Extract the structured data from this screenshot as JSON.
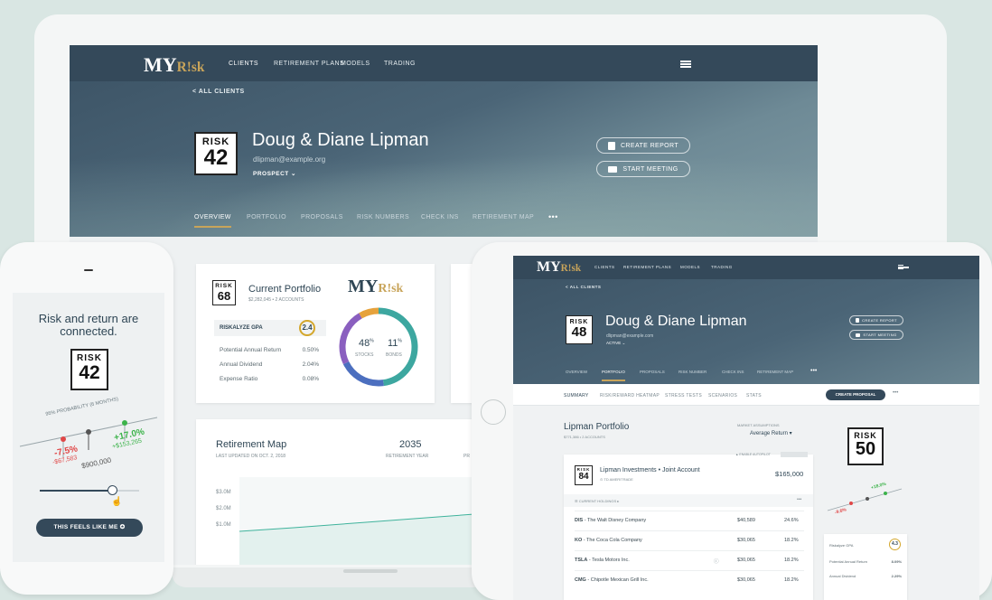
{
  "brand": {
    "logo_main": "MY",
    "logo_sub": "R!sk"
  },
  "laptop": {
    "nav": [
      "CLIENTS",
      "RETIREMENT PLANS",
      "MODELS",
      "TRADING"
    ],
    "back_link": "< ALL CLIENTS",
    "client": {
      "risk_label": "RISK",
      "risk_number": "42",
      "name": "Doug & Diane Lipman",
      "email": "dlipman@example.org",
      "status": "PROSPECT ⌄"
    },
    "buttons": {
      "create_report": "CREATE REPORT",
      "start_meeting": "START MEETING"
    },
    "tabs": [
      "OVERVIEW",
      "PORTFOLIO",
      "PROPOSALS",
      "RISK NUMBERS",
      "CHECK INS",
      "RETIREMENT MAP",
      "•••"
    ],
    "portfolio_card": {
      "risk_label": "RISK",
      "risk_number": "68",
      "title": "Current Portfolio",
      "subtitle": "$2,282,045 • 2 ACCOUNTS",
      "gpa_label": "RISKALYZE GPA",
      "gpa_value": "2.4",
      "rows": [
        {
          "label": "Potential Annual Return",
          "value": "0.50%"
        },
        {
          "label": "Annual Dividend",
          "value": "2.04%"
        },
        {
          "label": "Expense Ratio",
          "value": "0.08%"
        }
      ],
      "donut": {
        "stocks_pct": "48",
        "stocks_label": "STOCKS",
        "bonds_pct": "11",
        "bonds_label": "BONDS",
        "pct_sign": "%"
      }
    },
    "retirement_card": {
      "title": "Retirement Map",
      "updated": "LAST UPDATED ON OCT. 2, 2018",
      "year_value": "2035",
      "year_label": "RETIREMENT YEAR",
      "extra": "PR",
      "y_ticks": [
        "$3.0M",
        "$2.0M",
        "$1.0M"
      ]
    }
  },
  "phone": {
    "headline": "Risk and return are connected.",
    "risk_label": "RISK",
    "risk_number": "42",
    "probability": "95% PROBABILITY (6 MONTHS)",
    "down_pct": "-7.5%",
    "down_amt": "-$67,583",
    "up_pct": "+17.0%",
    "up_amt": "+$153,265",
    "center_amt": "$900,000",
    "cta": "THIS FEELS LIKE ME ✪"
  },
  "tablet": {
    "nav": [
      "CLIENTS",
      "RETIREMENT PLANS",
      "MODELS",
      "TRADING"
    ],
    "back_link": "< ALL CLIENTS",
    "client": {
      "risk_label": "RISK",
      "risk_number": "48",
      "name": "Doug & Diane Lipman",
      "email": "dlipman@example.com",
      "status": "ACTIVE ⌄"
    },
    "buttons": {
      "create_report": "CREATE REPORT",
      "start_meeting": "START MEETING"
    },
    "tabs": [
      "OVERVIEW",
      "PORTFOLIO",
      "PROPOSALS",
      "RISK NUMBER",
      "CHECK INS",
      "RETIREMENT MAP",
      "•••"
    ],
    "subtabs": [
      "SUMMARY",
      "RISK/REWARD HEATMAP",
      "STRESS TESTS",
      "SCENARIOS",
      "STATS"
    ],
    "create_proposal": "CREATE PROPOSAL",
    "portfolio_title": "Lipman Portfolio",
    "portfolio_sub": "$771,386 • 2 ACCOUNTS",
    "market_label": "MARKET ASSUMPTIONS",
    "market_value": "Average Return ▾",
    "account": {
      "risk_label": "RISK",
      "risk_number": "84",
      "name": "Lipman Investments • Joint Account",
      "sub": "⊙ TD AMERITRADE",
      "value": "$165,000",
      "autopilot": "▲ ENABLE AUTOPILOT"
    },
    "holdings_label": "☰ CURRENT HOLDINGS ▸",
    "holdings": [
      {
        "ticker": "DIS",
        "name": " - The Walt Disney Company",
        "value": "$40,589",
        "pct": "24.6%"
      },
      {
        "ticker": "KO",
        "name": " - The Coca Cola Company",
        "value": "$30,065",
        "pct": "18.2%"
      },
      {
        "ticker": "TSLA",
        "name": " - Tesla Motors Inc.",
        "value": "$30,065",
        "pct": "18.2%"
      },
      {
        "ticker": "CMG",
        "name": " - Chipotle Mexican Grill Inc.",
        "value": "$30,065",
        "pct": "18.2%"
      }
    ],
    "side": {
      "risk_label": "RISK",
      "risk_number": "50",
      "up": "+18.0%",
      "down": "-9.6%",
      "rows": [
        {
          "label": "Riskalyze GPA",
          "value": "4.3"
        },
        {
          "label": "Potential Annual Return",
          "value": "8.09%"
        },
        {
          "label": "Annual Dividend",
          "value": "2.29%"
        }
      ]
    }
  }
}
